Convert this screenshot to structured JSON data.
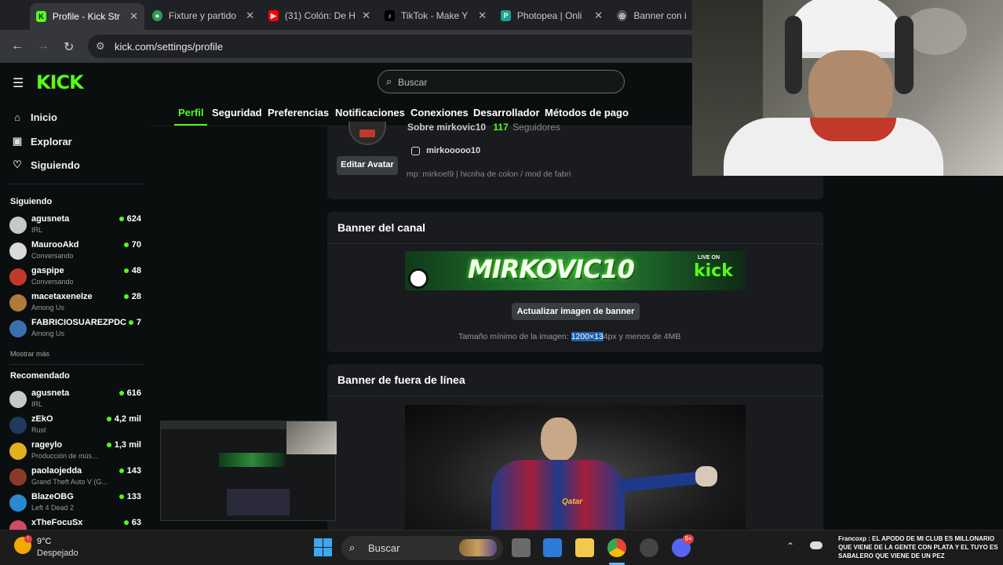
{
  "browser": {
    "tabs": [
      {
        "title": "Profile - Kick Str",
        "active": true
      },
      {
        "title": "Fixture y partido",
        "active": false
      },
      {
        "title": "(31) Colón: De H",
        "active": false
      },
      {
        "title": "TikTok - Make Y",
        "active": false
      },
      {
        "title": "Photopea | Onli",
        "active": false
      },
      {
        "title": "Banner con im",
        "active": false
      }
    ],
    "url": "kick.com/settings/profile"
  },
  "header": {
    "logo": "KICK",
    "search_placeholder": "Buscar"
  },
  "sidebar": {
    "nav": [
      {
        "label": "Inicio",
        "icon": "home-icon"
      },
      {
        "label": "Explorar",
        "icon": "explore-icon"
      },
      {
        "label": "Siguiendo",
        "icon": "heart-icon"
      }
    ],
    "following_title": "Siguiendo",
    "following": [
      {
        "name": "agusneta",
        "category": "IRL",
        "viewers": "624",
        "color": "#c8c8c8"
      },
      {
        "name": "MaurooAkd",
        "category": "Conversando",
        "viewers": "70",
        "color": "#d9d9d9"
      },
      {
        "name": "gaspipe",
        "category": "Conversando",
        "viewers": "48",
        "color": "#c0392b"
      },
      {
        "name": "macetaxenelze",
        "category": "Among Us",
        "viewers": "28",
        "color": "#b07a3a"
      },
      {
        "name": "FABRICIOSUAREZPDC",
        "category": "Among Us",
        "viewers": "7",
        "color": "#3a6fb0"
      }
    ],
    "show_more": "Mostrar más",
    "recommended_title": "Recomendado",
    "recommended": [
      {
        "name": "agusneta",
        "category": "IRL",
        "viewers": "616",
        "color": "#c8c8c8"
      },
      {
        "name": "zEkO",
        "category": "Rust",
        "viewers": "4,2 mil",
        "color": "#1f3a5a"
      },
      {
        "name": "rageylo",
        "category": "Producción de mús...",
        "viewers": "1,3 mil",
        "color": "#e0b020"
      },
      {
        "name": "paolaojedda",
        "category": "Grand Theft Auto V (G...",
        "viewers": "143",
        "color": "#8a3a2a"
      },
      {
        "name": "BlazeOBG",
        "category": "Left 4 Dead 2",
        "viewers": "133",
        "color": "#2a8ad0"
      },
      {
        "name": "xTheFocuSx",
        "category": "",
        "viewers": "63",
        "color": "#d04a6a"
      }
    ]
  },
  "settings_tabs": [
    "Perfil",
    "Seguridad",
    "Preferencias",
    "Notificaciones",
    "Conexiones",
    "Desarrollador",
    "Métodos de pago"
  ],
  "profile": {
    "about": "Sobre mirkovic10",
    "followers_count": "117",
    "followers_label": "Seguidores",
    "instagram": "mirkooooo10",
    "bio": "mp: mirkoel9 | hicnha de colon / mod de fabri",
    "edit_avatar": "Editar Avatar"
  },
  "banner_card": {
    "title": "Banner del canal",
    "banner_text": "MIRKOVIC10",
    "live_on": "LIVE ON",
    "kick": "kick",
    "update_button": "Actualizar imagen de banner",
    "hint_prefix": "Tamaño mínimo de la imagen:",
    "hint_highlight": "1200×13",
    "hint_suffix": "4px y menos de 4MB"
  },
  "offline_card": {
    "title": "Banner de fuera de línea",
    "jersey_text": "Qatar"
  },
  "taskbar": {
    "weather_temp": "9°C",
    "weather_desc": "Despejado",
    "search": "Buscar",
    "discord_badge": "9+",
    "chat_message": "Francoxp : EL APODO DE MI CLUB ES MILLONARIO QUE VIENE DE LA GENTE CON PLATA Y EL TUYO ES SABALERO QUE VIENE DE UN PEZ"
  }
}
